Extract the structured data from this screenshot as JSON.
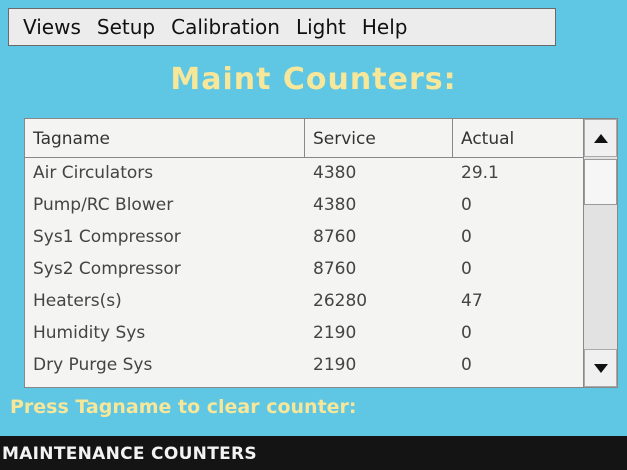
{
  "menu": {
    "items": [
      "Views",
      "Setup",
      "Calibration",
      "Light",
      "Help"
    ]
  },
  "title": "Maint Counters:",
  "table": {
    "headers": {
      "tagname": "Tagname",
      "service": "Service",
      "actual": "Actual"
    },
    "rows": [
      {
        "tagname": "Air Circulators",
        "service": "4380",
        "actual": "29.1"
      },
      {
        "tagname": "Pump/RC Blower",
        "service": "4380",
        "actual": "0"
      },
      {
        "tagname": "Sys1 Compressor",
        "service": "8760",
        "actual": "0"
      },
      {
        "tagname": "Sys2 Compressor",
        "service": "8760",
        "actual": "0"
      },
      {
        "tagname": "Heaters(s)",
        "service": "26280",
        "actual": "47"
      },
      {
        "tagname": "Humidity Sys",
        "service": "2190",
        "actual": "0"
      },
      {
        "tagname": "Dry Purge Sys",
        "service": "2190",
        "actual": "0"
      }
    ]
  },
  "hint": "Press Tagname to clear counter:",
  "status": "MAINTENANCE COUNTERS",
  "icons": {
    "scroll_up": "triangle-up-icon",
    "scroll_down": "triangle-down-icon"
  },
  "colors": {
    "background": "#5fc6e3",
    "title": "#f6e79a",
    "statusbar": "#141414"
  }
}
